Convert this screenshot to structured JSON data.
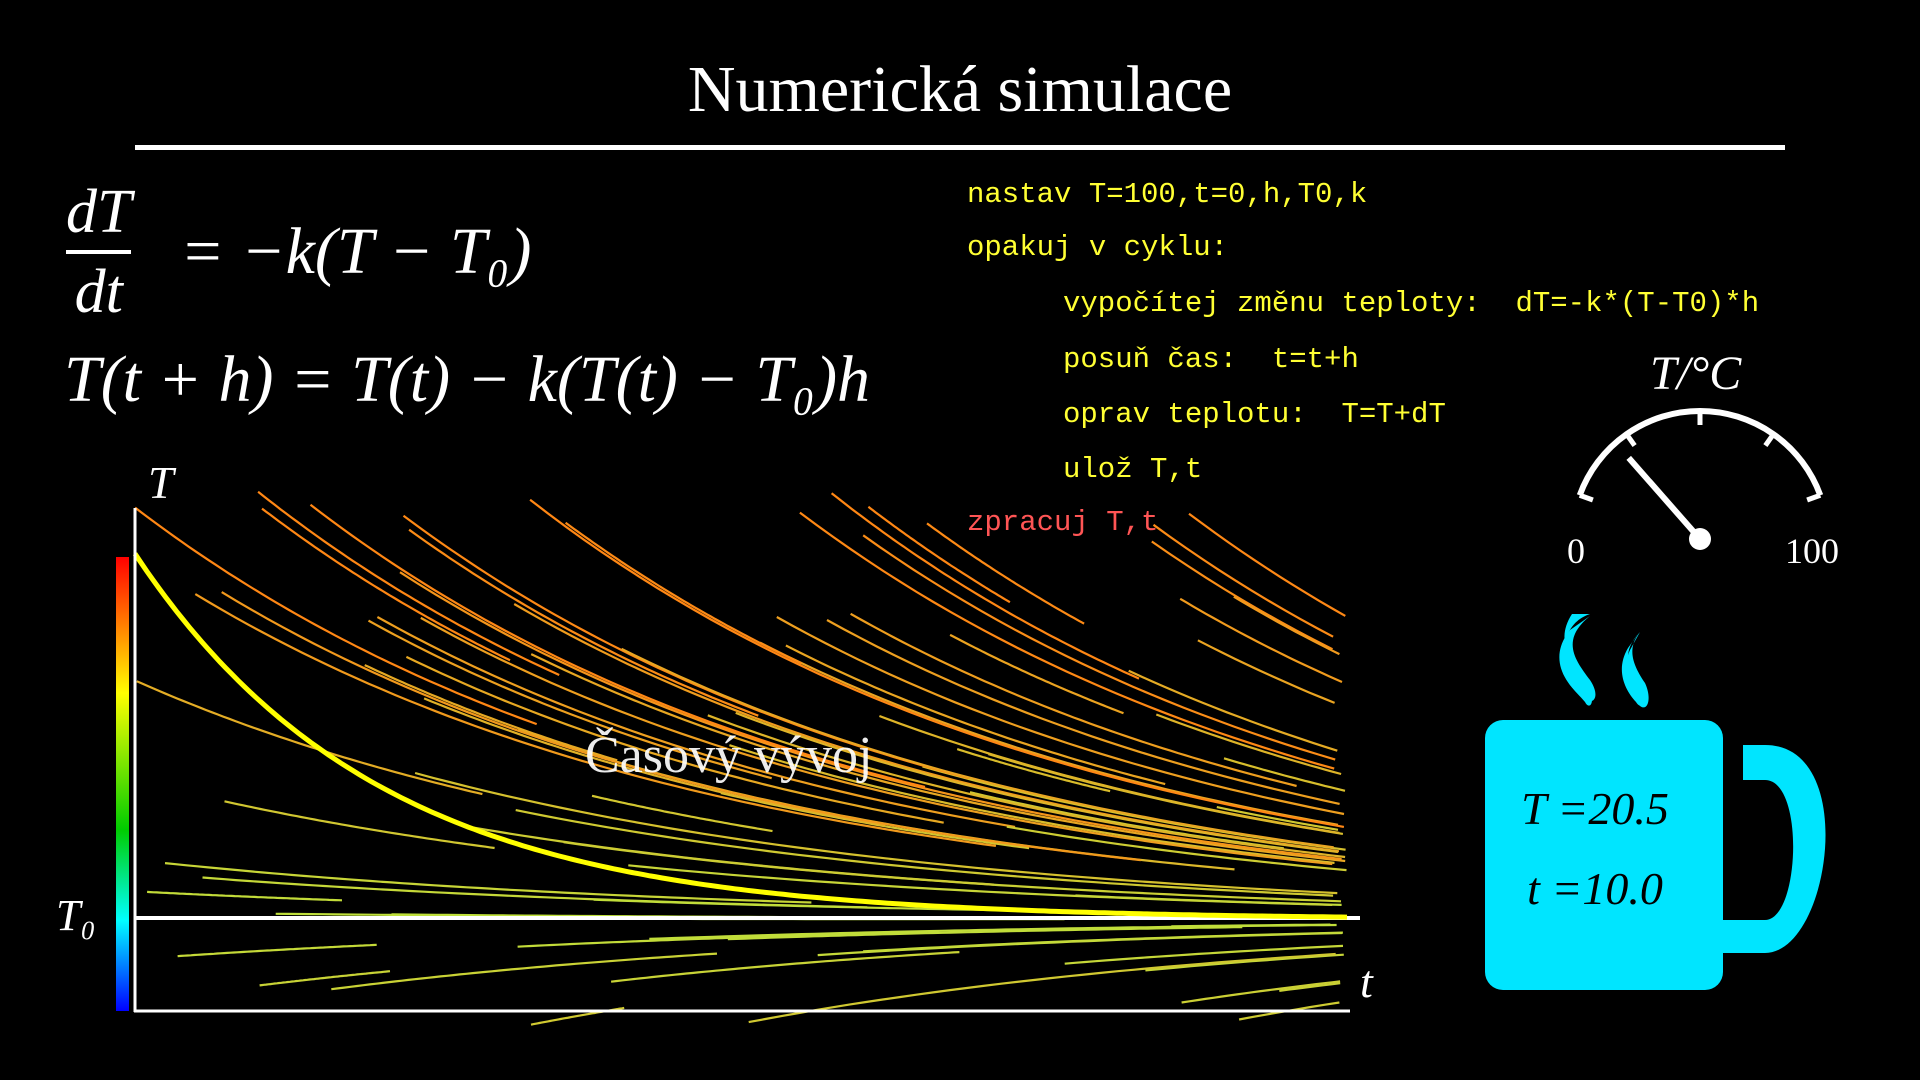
{
  "title": "Numerická simulace",
  "equations": {
    "ode_num": "dT",
    "ode_den": "dt",
    "ode_rhs": "= −k(T − T₀)",
    "euler": "T(t + h) = T(t) − k(T(t) − T₀)h"
  },
  "code": {
    "lines": [
      {
        "text": "nastav T=100,t=0,h,T0,k",
        "indent": 0,
        "color": "#ffff33"
      },
      {
        "text": "opakuj v cyklu:",
        "indent": 0,
        "color": "#ffff33"
      },
      {
        "text": "vypočítej změnu teploty:  dT=-k*(T-T0)*h",
        "indent": 1,
        "color": "#ffff33"
      },
      {
        "text": "posuň čas:  t=t+h",
        "indent": 1,
        "color": "#ffff33"
      },
      {
        "text": "oprav teplotu:  T=T+dT",
        "indent": 1,
        "color": "#ffff33"
      },
      {
        "text": "ulož T,t",
        "indent": 1,
        "color": "#ffff33"
      },
      {
        "text": "zpracuj T,t",
        "indent": 0,
        "color": "#ff5555"
      }
    ]
  },
  "gauge": {
    "label": "T/°C",
    "min_label": "0",
    "max_label": "100",
    "value": 20.5,
    "min": 0,
    "max": 100
  },
  "mug": {
    "T_text": "T =20.5",
    "t_text": "t =10.0",
    "color": "#00e5ff"
  },
  "chart_data": {
    "type": "line",
    "xlabel": "t",
    "ylabel": "T",
    "reference_line_label": "T₀",
    "annotation": "Časový vývoj",
    "T0": 20,
    "xlim": [
      0,
      10
    ],
    "ylim": [
      0,
      110
    ],
    "series": [
      {
        "x": [
          0,
          1,
          2,
          3,
          4,
          5,
          6,
          7,
          8,
          9,
          10
        ],
        "values": [
          100,
          68.5,
          49.4,
          37.9,
          30.8,
          26.6,
          24.0,
          22.4,
          21.5,
          20.9,
          20.5
        ],
        "color": "#ffff00"
      }
    ],
    "colorbar": [
      "#ff0000",
      "#ffff00",
      "#00cc00",
      "#00ffff",
      "#0000ff"
    ]
  }
}
